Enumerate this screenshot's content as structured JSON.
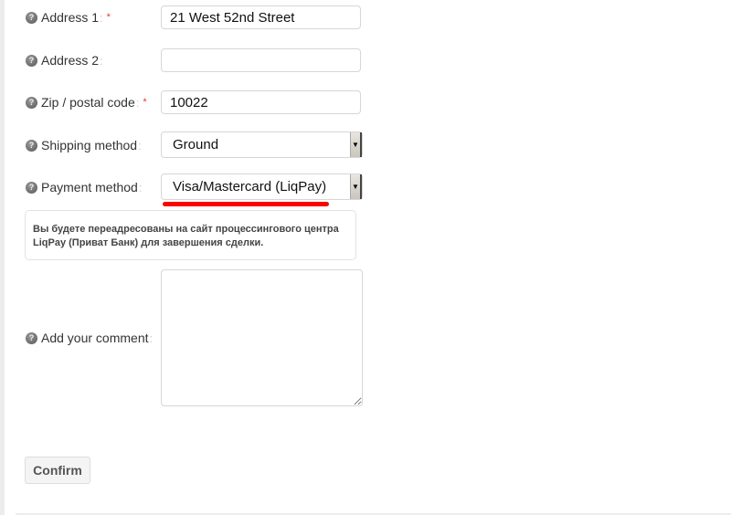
{
  "form": {
    "address1": {
      "label": "Address 1",
      "colon": ":",
      "required_mark": "*",
      "value": "21 West 52nd Street"
    },
    "address2": {
      "label": "Address 2",
      "colon": ":",
      "value": ""
    },
    "zip": {
      "label": "Zip / postal code",
      "colon": ":",
      "required_mark": "*",
      "value": "10022"
    },
    "shipping": {
      "label": "Shipping method",
      "colon": ":",
      "selected": "Ground"
    },
    "payment": {
      "label": "Payment method",
      "colon": ":",
      "selected": "Visa/Mastercard (LiqPay)",
      "highlight_color": "#ff0000"
    },
    "notice": {
      "line1": "Вы будете переадресованы на сайт процессингового центра",
      "line2": "LiqPay (Приват Банк) для завершения сделки."
    },
    "comment": {
      "label": "Add your comment",
      "colon": ":",
      "value": ""
    },
    "confirm_label": "Confirm"
  },
  "icons": {
    "help": "?",
    "dropdown_arrow": "▼"
  }
}
